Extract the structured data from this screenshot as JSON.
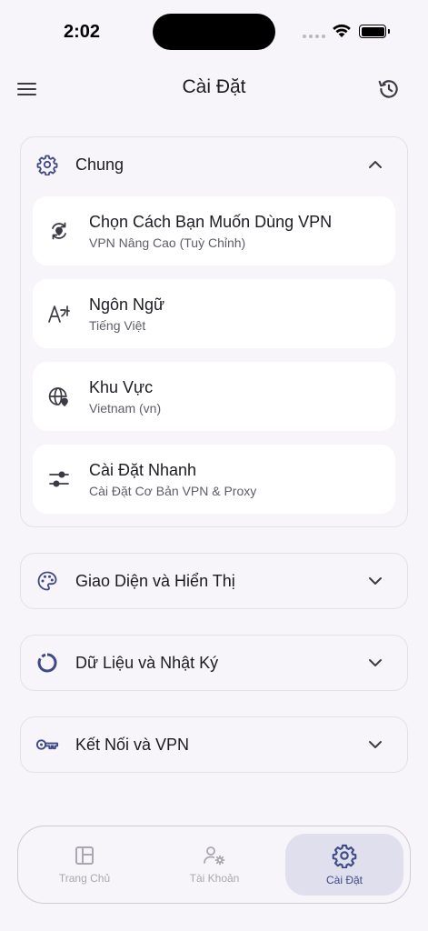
{
  "status_bar": {
    "time": "2:02"
  },
  "app_bar": {
    "title": "Cài Đặt"
  },
  "sections": {
    "general": {
      "title": "Chung",
      "items": [
        {
          "label": "Chọn Cách Bạn Muốn Dùng VPN",
          "value": "VPN Nâng Cao (Tuỳ Chỉnh)",
          "icon": "vpn-mode-icon"
        },
        {
          "label": "Ngôn Ngữ",
          "value": "Tiếng Việt",
          "icon": "translate-icon"
        },
        {
          "label": "Khu Vực",
          "value": "Vietnam (vn)",
          "icon": "globe-location-icon"
        },
        {
          "label": "Cài Đặt Nhanh",
          "value": "Cài Đặt Cơ Bản VPN & Proxy",
          "icon": "sliders-icon"
        }
      ]
    },
    "appearance": {
      "title": "Giao Diện và Hiển Thị",
      "icon": "palette-icon"
    },
    "data_logs": {
      "title": "Dữ Liệu và Nhật Ký",
      "icon": "donut-chart-icon"
    },
    "connection": {
      "title": "Kết Nối và VPN",
      "icon": "key-icon"
    }
  },
  "bottom_nav": {
    "items": [
      {
        "label": "Trang Chủ",
        "icon": "dashboard-icon",
        "active": false
      },
      {
        "label": "Tài Khoản",
        "icon": "user-settings-icon",
        "active": false
      },
      {
        "label": "Cài Đặt",
        "icon": "gear-icon",
        "active": true
      }
    ]
  },
  "colors": {
    "background": "#f7f4fa",
    "accent": "#3e4a86",
    "card": "#ffffff",
    "active_nav_bg": "#dfdfee"
  }
}
